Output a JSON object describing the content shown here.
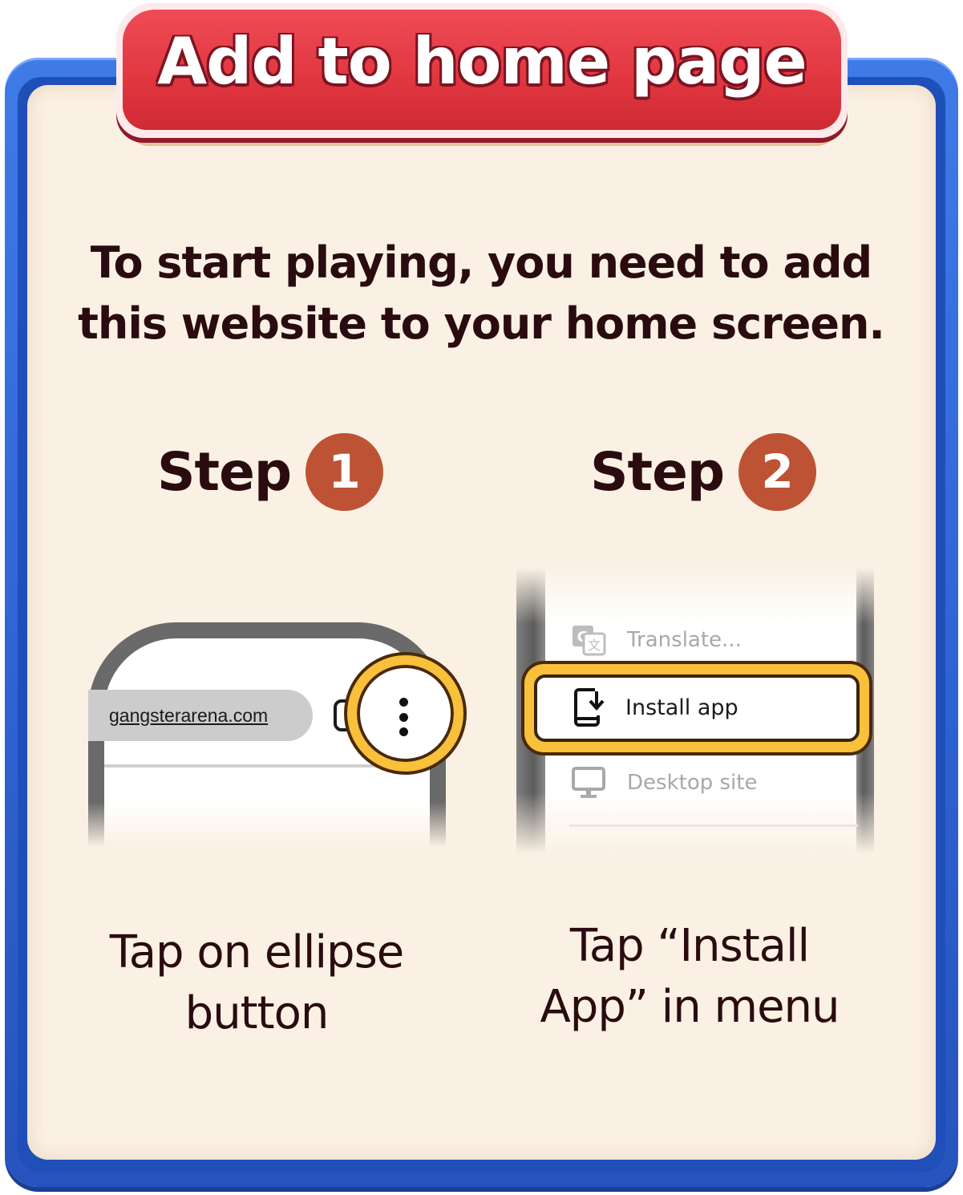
{
  "title": "Add to home page",
  "intro": "To start playing, you need to add this website to your home screen.",
  "steps": [
    {
      "word": "Step",
      "number": "1",
      "caption": "Tap on ellipse button",
      "illustration": {
        "url": "gangsterarena.com",
        "icons": [
          "tabs-icon",
          "ellipsis-vertical-icon"
        ]
      }
    },
    {
      "word": "Step",
      "number": "2",
      "caption": "Tap “Install App” in menu",
      "illustration": {
        "menu_items": [
          {
            "label": "Translate...",
            "icon": "translate-icon",
            "highlighted": false
          },
          {
            "label": "Install app",
            "icon": "install-app-icon",
            "highlighted": true
          },
          {
            "label": "Desktop site",
            "icon": "desktop-icon",
            "highlighted": false
          }
        ]
      }
    }
  ],
  "colors": {
    "frame_blue": "#2f63d2",
    "ribbon_red": "#e0363f",
    "panel_cream": "#faf1e4",
    "step_badge": "#bd5334",
    "highlight_yellow": "#f8c03b",
    "text_dark": "#2a0c10"
  }
}
